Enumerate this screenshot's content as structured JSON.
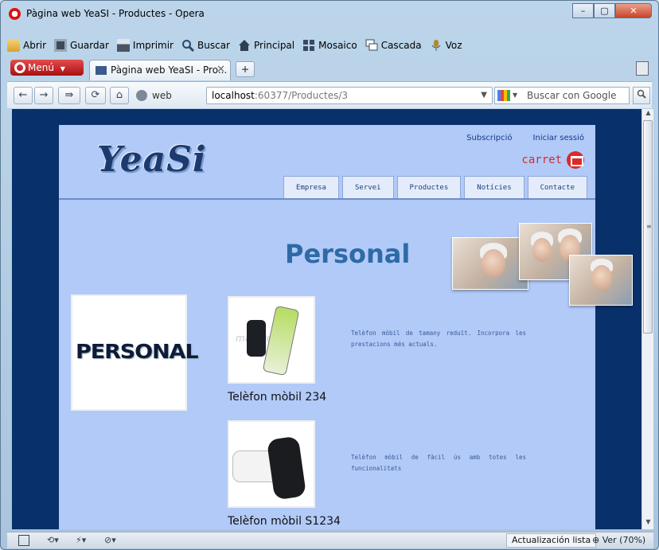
{
  "window": {
    "title": "Pàgina web YeaSI - Productes - Opera",
    "minimize": "–",
    "maximize": "▢",
    "close": "✕"
  },
  "menubar": [
    {
      "label": "Abrir",
      "icon": "folder-icon"
    },
    {
      "label": "Guardar",
      "icon": "save-icon"
    },
    {
      "label": "Imprimir",
      "icon": "print-icon"
    },
    {
      "label": "Buscar",
      "icon": "search-icon"
    },
    {
      "label": "Principal",
      "icon": "home-icon"
    },
    {
      "label": "Mosaico",
      "icon": "tile-icon"
    },
    {
      "label": "Cascada",
      "icon": "cascade-icon"
    },
    {
      "label": "Voz",
      "icon": "microphone-icon"
    }
  ],
  "tabbar": {
    "menu_label": "Menú",
    "tab_title": "Pàgina web YeaSI - Pro...",
    "tab_close": "✕",
    "new_tab": "+"
  },
  "addressbar": {
    "web_label": "web",
    "url_host": "localhost",
    "url_path": ":60377/Productes/3",
    "search_placeholder": "Buscar con Google"
  },
  "site": {
    "logo": "YeaSi",
    "links": {
      "subscribe": "Subscripció",
      "login": "Iniciar sessió"
    },
    "cart": "carret",
    "nav": [
      "Empresa",
      "Servei",
      "Productes",
      "Notícies",
      "Contacte"
    ],
    "heading": "Personal",
    "category_image_text": "PERSONAL",
    "watermark": "mayores.",
    "products": [
      {
        "name": "Telèfon mòbil 234",
        "description": "Telèfon mòbil de tamany reduït. Incorpora les prestacions més actuals."
      },
      {
        "name": "Telèfon mòbil S1234",
        "description": "Telèfon mòbil de fàcil ús amb totes les funcionalitats"
      }
    ]
  },
  "statusbar": {
    "status": "Actualización lista",
    "zoom": "Ver (70%)"
  },
  "colors": {
    "page_bg": "#08306b",
    "content_bg": "#b2caf8",
    "heading": "#2e6aa6",
    "cart_red": "#d92b2b"
  }
}
